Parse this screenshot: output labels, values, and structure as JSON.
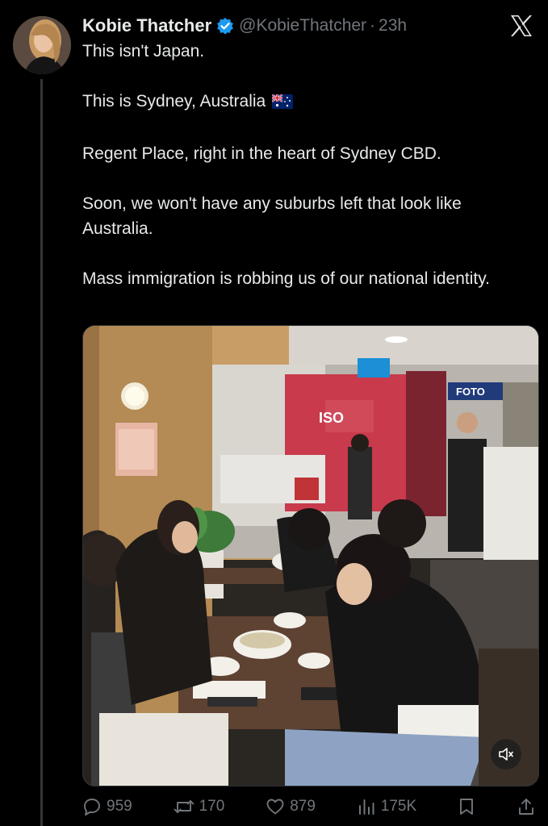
{
  "tweet": {
    "author_name": "Kobie Thatcher",
    "handle": "@KobieThatcher",
    "separator": "·",
    "time": "23h",
    "paragraphs": [
      "This isn't Japan.",
      "This is Sydney, Australia",
      "Regent Place, right in the heart of Sydney CBD.",
      "Soon, we won't have any suburbs left that look like Australia.",
      "Mass immigration is robbing us of our national identity."
    ],
    "flag_emoji": "australia-flag",
    "media": {
      "type": "video",
      "storefront_sign": "ISO",
      "shop_sign": "FOTO",
      "mute_icon": "volume-muted-icon"
    }
  },
  "actions": {
    "replies": "959",
    "reposts": "170",
    "likes": "879",
    "views": "175K"
  },
  "colors": {
    "background": "#000000",
    "text": "#e7e9ea",
    "secondary": "#71767b",
    "verified": "#1d9bf0",
    "thread_line": "#333639"
  }
}
